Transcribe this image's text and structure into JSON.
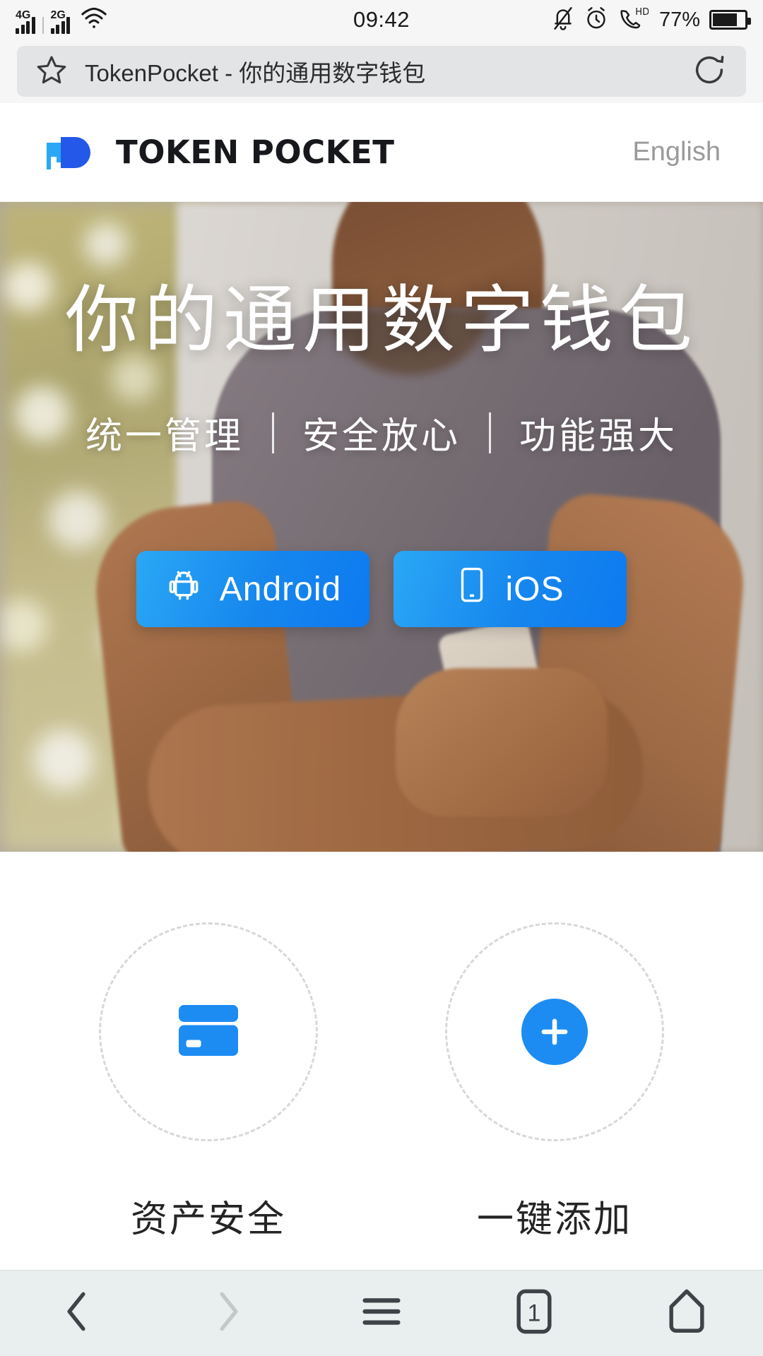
{
  "status_bar": {
    "network_primary": "4G",
    "network_secondary": "2G",
    "wifi_icon": "wifi-icon",
    "time": "09:42",
    "mute_icon": "bell-mute-icon",
    "alarm_icon": "alarm-clock-icon",
    "hd_call_icon": "hd-call-icon",
    "battery_percent": "77%",
    "battery_level": 77
  },
  "browser": {
    "bookmark_icon": "star-icon",
    "page_title": "TokenPocket - 你的通用数字钱包",
    "refresh_icon": "refresh-icon"
  },
  "site_header": {
    "logo_icon": "tokenpocket-logo-icon",
    "wordmark": "TOKEN POCKET",
    "language_label": "English",
    "logo_color_light": "#2aa8f5",
    "logo_color_dark": "#2358e8"
  },
  "hero": {
    "title": "你的通用数字钱包",
    "features": [
      "统一管理",
      "安全放心",
      "功能强大"
    ],
    "buttons": [
      {
        "label": "Android",
        "icon": "android-robot-icon"
      },
      {
        "label": "iOS",
        "icon": "mobile-phone-icon"
      }
    ],
    "button_color": "#1686ee"
  },
  "feature_cards": [
    {
      "label": "资产安全",
      "icon": "wallet-card-icon",
      "icon_color": "#1c8cf3"
    },
    {
      "label": "一键添加",
      "icon": "plus-circle-icon",
      "icon_color": "#1c8cf3"
    }
  ],
  "bottom_nav": [
    {
      "name": "back",
      "icon": "chevron-left-icon",
      "label": ""
    },
    {
      "name": "forward",
      "icon": "chevron-right-icon",
      "label": ""
    },
    {
      "name": "menu",
      "icon": "hamburger-menu-icon",
      "label": ""
    },
    {
      "name": "tabs",
      "icon": "tab-count-icon",
      "label": "1"
    },
    {
      "name": "home",
      "icon": "home-icon",
      "label": ""
    }
  ]
}
